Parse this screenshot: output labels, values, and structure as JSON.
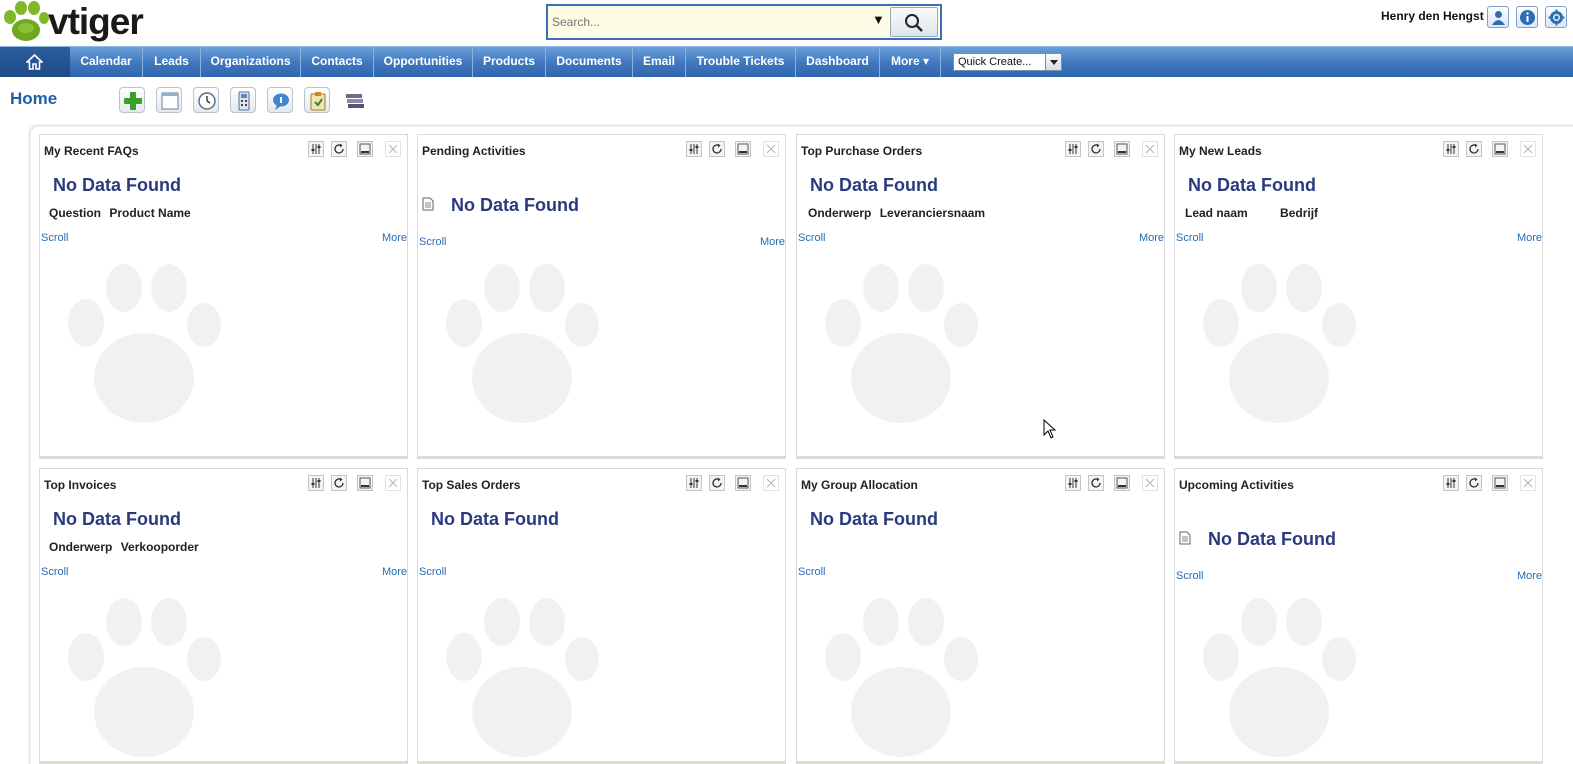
{
  "header": {
    "logo_text": "vtiger",
    "search": {
      "placeholder": "Search..."
    },
    "user_name": "Henry den Hengst",
    "icons": [
      "user-icon",
      "info-icon",
      "settings-icon"
    ]
  },
  "nav": {
    "items": [
      {
        "label": "Calendar"
      },
      {
        "label": "Leads"
      },
      {
        "label": "Organizations"
      },
      {
        "label": "Contacts"
      },
      {
        "label": "Opportunities"
      },
      {
        "label": "Products"
      },
      {
        "label": "Documents"
      },
      {
        "label": "Email"
      },
      {
        "label": "Trouble Tickets"
      },
      {
        "label": "Dashboard"
      },
      {
        "label": "More ▾"
      }
    ],
    "quick_create": "Quick Create..."
  },
  "page": {
    "title": "Home",
    "toolbar": [
      "add-icon",
      "window-icon",
      "clock-icon",
      "calculator-icon",
      "chat-icon",
      "clipboard-icon",
      "stack-icon"
    ]
  },
  "widgets": [
    {
      "title": "My Recent FAQs",
      "nodata": "No Data Found",
      "columns": [
        "Question",
        "Product Name"
      ],
      "scroll": "Scroll",
      "more": "More"
    },
    {
      "title": "Pending Activities",
      "nodata": "No Data Found",
      "scroll": "Scroll",
      "more": "More"
    },
    {
      "title": "Top Purchase Orders",
      "nodata": "No Data Found",
      "columns": [
        "Onderwerp",
        "Leveranciersnaam"
      ],
      "scroll": "Scroll",
      "more": "More"
    },
    {
      "title": "My New Leads",
      "nodata": "No Data Found",
      "columns": [
        "Lead naam",
        "Bedrijf"
      ],
      "scroll": "Scroll",
      "more": "More"
    },
    {
      "title": "Top Invoices",
      "nodata": "No Data Found",
      "columns": [
        "Onderwerp",
        "Verkooporder"
      ],
      "scroll": "Scroll",
      "more": "More"
    },
    {
      "title": "Top Sales Orders",
      "nodata": "No Data Found",
      "scroll": "Scroll"
    },
    {
      "title": "My Group Allocation",
      "nodata": "No Data Found",
      "scroll": "Scroll"
    },
    {
      "title": "Upcoming Activities",
      "nodata": "No Data Found",
      "scroll": "Scroll",
      "more": "More"
    }
  ],
  "colors": {
    "nav_bar": "#3f76bd",
    "title_link": "#1f5fa6",
    "nodata_text": "#2b3a7e",
    "link": "#2a6bb0",
    "search_bg": "#fdfde6"
  }
}
